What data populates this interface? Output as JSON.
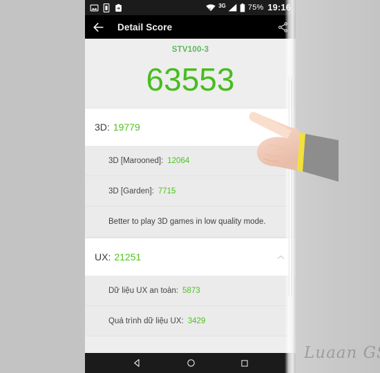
{
  "status_bar": {
    "left_icons": [
      {
        "name": "image-icon",
        "label": "Screenshot"
      },
      {
        "name": "sim-card-icon",
        "label": "SIM"
      },
      {
        "name": "clipboard-icon",
        "label": "Clipboard"
      }
    ],
    "wifi_icon": "wifi-icon",
    "network_type": "3G",
    "signal_icon": "signal-bars-icon",
    "battery_icon": "battery-icon",
    "battery_percent": "75%",
    "clock": "19:16"
  },
  "app_bar": {
    "back_icon": "back-arrow-icon",
    "title": "Detail Score",
    "share_icon": "share-icon"
  },
  "hero": {
    "device_model": "STV100-3",
    "total_score": "63553",
    "score_color": "#47bd1e"
  },
  "sections": [
    {
      "id": "3d",
      "label": "3D:",
      "value": "19779",
      "chevron": null,
      "rows": [
        {
          "type": "score",
          "label": "3D [Marooned]:",
          "value": "12064"
        },
        {
          "type": "score",
          "label": "3D [Garden]:",
          "value": "7715"
        },
        {
          "type": "note",
          "label": "Better to play 3D games in low quality mode.",
          "value": ""
        }
      ]
    },
    {
      "id": "ux",
      "label": "UX:",
      "value": "21251",
      "chevron": "chevron-up-icon",
      "rows": [
        {
          "type": "score",
          "label": "Dữ liệu UX an toàn:",
          "value": "5873"
        },
        {
          "type": "score",
          "label": "Quá trình dữ liệu UX:",
          "value": "3429"
        }
      ]
    }
  ],
  "nav_bar": {
    "back": "nav-back-icon",
    "home": "nav-home-icon",
    "recents": "nav-recents-icon"
  },
  "overlay": {
    "hand": "pointing-hand-icon",
    "watermark": "Luaan GS"
  }
}
